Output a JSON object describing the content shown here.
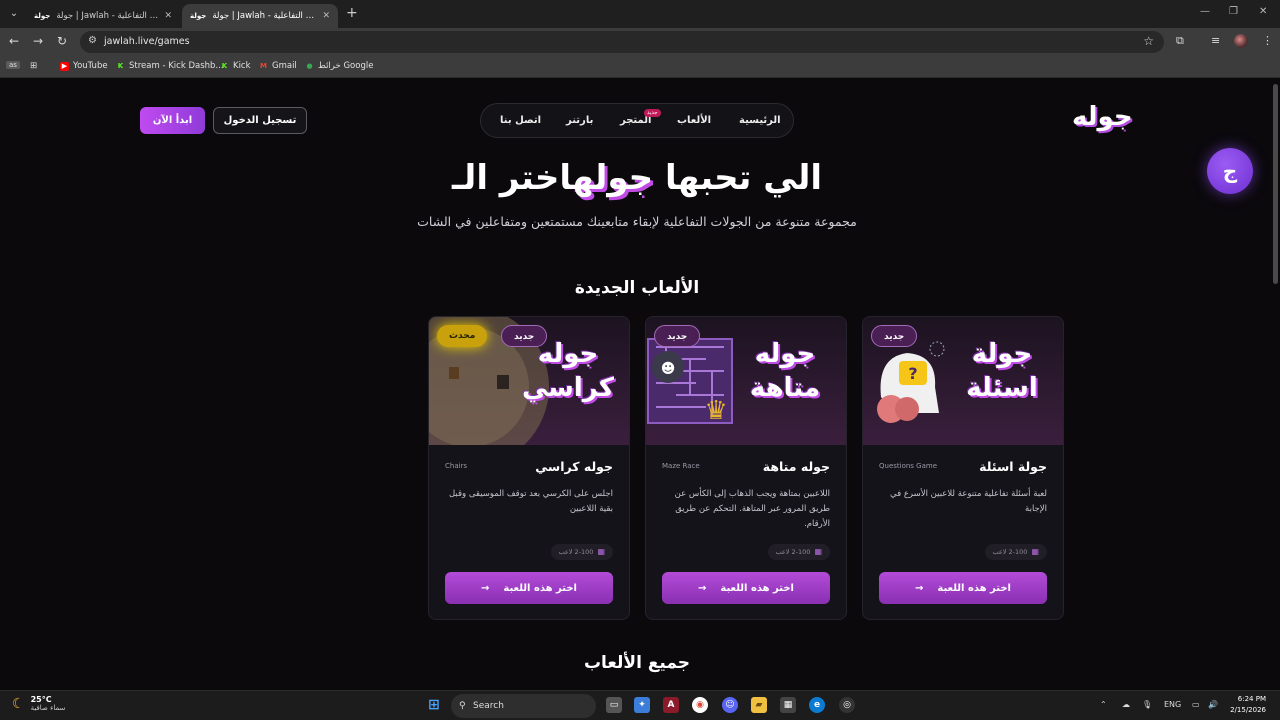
{
  "browser": {
    "tabs": [
      {
        "favicon": "جولة",
        "title": "جولة | Jawlah - منصة الألعاب التفاعلية"
      },
      {
        "favicon": "جولة",
        "title": "جولة | Jawlah - منصة الألعاب التفاعلية"
      }
    ],
    "url": "jawlah.live/games",
    "bookmarks": [
      {
        "label": "YouTube",
        "icon": "youtube-icon",
        "color": "#ff0000"
      },
      {
        "label": "Stream - Kick Dashb...",
        "icon": "kick-icon",
        "color": "#53fc18"
      },
      {
        "label": "Kick",
        "icon": "kick-icon",
        "color": "#53fc18"
      },
      {
        "label": "Gmail",
        "icon": "gmail-icon",
        "color": "#ea4335"
      },
      {
        "label": "خرائط Google",
        "icon": "maps-icon",
        "color": "#34a853"
      }
    ],
    "profile_badge": "as"
  },
  "site": {
    "logo": "جوله",
    "nav": [
      "الرئيسية",
      "الألعاب",
      "المتجر",
      "بارتنر",
      "اتصل بنا"
    ],
    "nav_new_badge": "جديد",
    "login_button": "تسجيل الدخول",
    "start_button": "ابدأ الآن",
    "hero": {
      "title_part1": "اختر الـ",
      "title_accent": "جوله",
      "title_part2": "الي تحبها",
      "subtitle": "مجموعة متنوعة من الجولات التفاعلية لإبقاء متابعينك مستمتعين ومتفاعلين في الشات"
    },
    "new_games_title": "الألعاب الجديدة",
    "all_games_title": "جميع الألعاب",
    "fab_icon": "jawlah-chat-icon"
  },
  "games": [
    {
      "art_title": "جولة اسئلة",
      "title": "جولة اسئلة",
      "en": "Questions Game",
      "desc": "لعبة أسئلة تفاعلية متنوعة للاعبين الأسرع في الإجابة",
      "players": "2-100 لاعب",
      "button": "اختر هذه اللعبة",
      "badges": [
        "جديد"
      ]
    },
    {
      "art_title": "جوله متاهة",
      "title": "جوله متاهة",
      "en": "Maze Race",
      "desc": "اللاعبين بمتاهة ويجب الذهاب إلى الكأس عن طريق المرور عبر المتاهة. التحكم عن طريق الأرقام.",
      "players": "2-100 لاعب",
      "button": "اختر هذه اللعبة",
      "badges": [
        "جديد"
      ]
    },
    {
      "art_title": "جوله كراسي",
      "title": "جوله كراسي",
      "en": "Chairs",
      "desc": "اجلس على الكرسي بعد توقف الموسيقى وقبل بقية اللاعبين",
      "players": "2-100 لاعب",
      "button": "اختر هذه اللعبة",
      "badges": [
        "جديد",
        "محدث"
      ]
    }
  ],
  "taskbar": {
    "weather_temp": "25°C",
    "weather_desc": "سماء صافية",
    "search": "Search",
    "lang": "ENG",
    "time": "6:24 PM",
    "date": "2/15/2026"
  },
  "colors": {
    "accent": "#b34bd8",
    "background": "#0b090c",
    "update_badge": "#c9a10c"
  }
}
